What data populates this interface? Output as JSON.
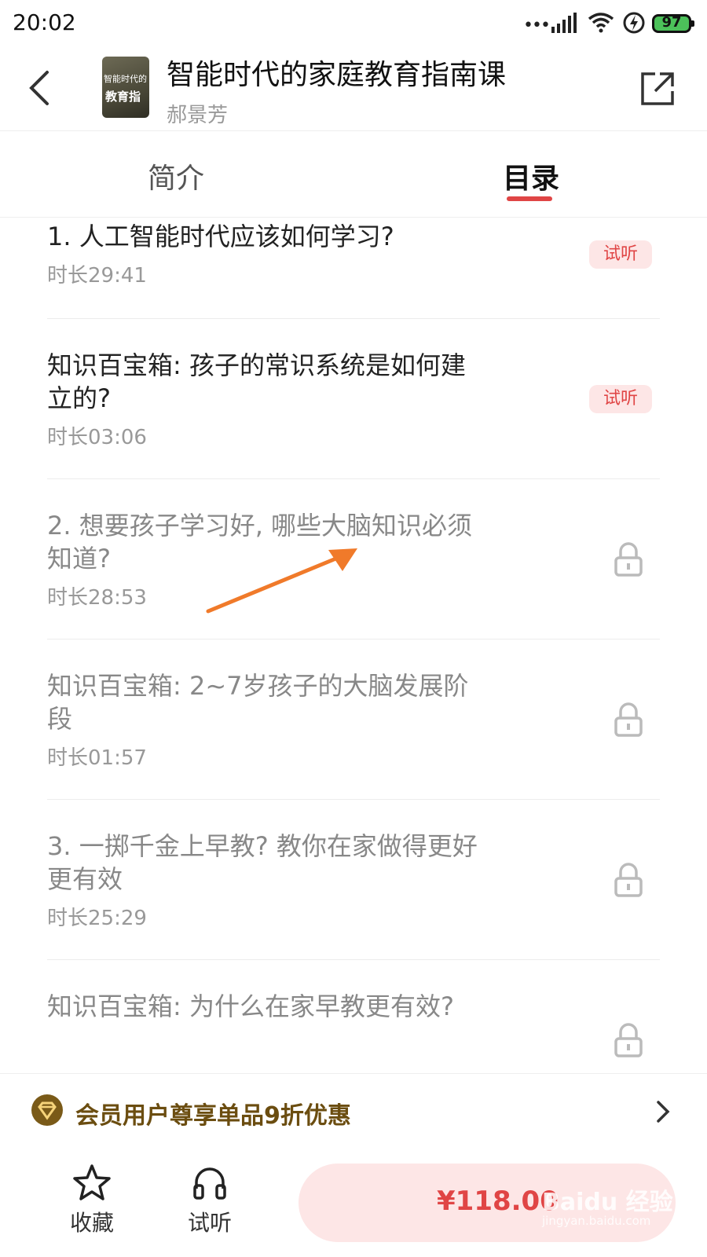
{
  "status_bar": {
    "time": "20:02",
    "battery": "97"
  },
  "header": {
    "title": "智能时代的家庭教育指南课",
    "author": "郝景芳",
    "cover_text_1": "智能时代的",
    "cover_text_2": "教育指"
  },
  "tabs": [
    {
      "label": "简介"
    },
    {
      "label": "目录"
    }
  ],
  "items": [
    {
      "title": "1. 人工智能时代应该如何学习?",
      "duration": "时长29:41",
      "badge": "试听"
    },
    {
      "title": "知识百宝箱: 孩子的常识系统是如何建立的?",
      "duration": "时长03:06",
      "badge": "试听"
    },
    {
      "title": "2. 想要孩子学习好, 哪些大脑知识必须知道?",
      "duration": "时长28:53"
    },
    {
      "title": "知识百宝箱: 2~7岁孩子的大脑发展阶段",
      "duration": "时长01:57"
    },
    {
      "title": "3. 一掷千金上早教? 教你在家做得更好更有效",
      "duration": "时长25:29"
    },
    {
      "title": "知识百宝箱: 为什么在家早教更有效?"
    }
  ],
  "member_banner": {
    "text": "会员用户尊享单品9折优惠"
  },
  "bottom_bar": {
    "favorite_label": "收藏",
    "preview_label": "试听",
    "price": "¥118.00"
  },
  "watermark": {
    "line1": "Baidu 经验",
    "line2": "jingyan.baidu.com"
  },
  "colors": {
    "accent": "#e04545",
    "badge_bg": "#fde6e6",
    "member_text": "#6b4d10",
    "annotation_arrow": "#f07a2a"
  },
  "icons": [
    "back-icon",
    "share-icon",
    "lock-icon",
    "crown-icon",
    "chevron-right-icon",
    "star-icon",
    "headphones-icon"
  ]
}
